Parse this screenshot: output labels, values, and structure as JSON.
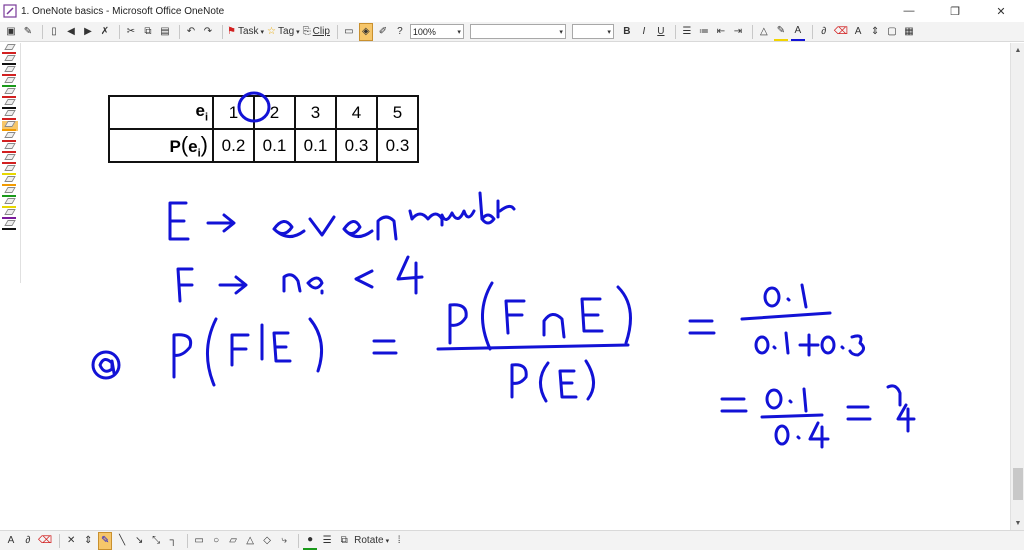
{
  "window": {
    "title": "1. OneNote basics - Microsoft Office OneNote",
    "controls": {
      "minimize": "—",
      "restore": "❐",
      "close": "✕"
    }
  },
  "toolbar": {
    "task_label": "Task",
    "tag_label": "Tag",
    "clip_label": "Clip",
    "zoom_value": "100%",
    "font_value": "",
    "size_value": "",
    "bold": "B",
    "italic": "I",
    "underline": "U"
  },
  "table": {
    "row1_header": "e",
    "row1_header_sub": "i",
    "row2_header": "P",
    "row2_header_paren_open": "(",
    "row2_header_e": "e",
    "row2_header_sub": "i",
    "row2_header_paren_close": ")",
    "outcomes": [
      "1",
      "2",
      "3",
      "4",
      "5"
    ],
    "probabilities": [
      "0.2",
      "0.1",
      "0.1",
      "0.3",
      "0.3"
    ]
  },
  "bottom_toolbar": {
    "rotate_label": "Rotate"
  },
  "colors": {
    "ink": "#1212d6",
    "highlight": "#f6c66a",
    "pen_colors": [
      "#d22020",
      "#111111",
      "#d22020",
      "#1a9a1a",
      "#d22020",
      "#111111",
      "#d22020",
      "#f29a00",
      "#d22020",
      "#d22020",
      "#d22020",
      "#e8d800",
      "#f29a00",
      "#1a9a1a",
      "#e8d800",
      "#7a1a9a",
      "#111111"
    ]
  }
}
